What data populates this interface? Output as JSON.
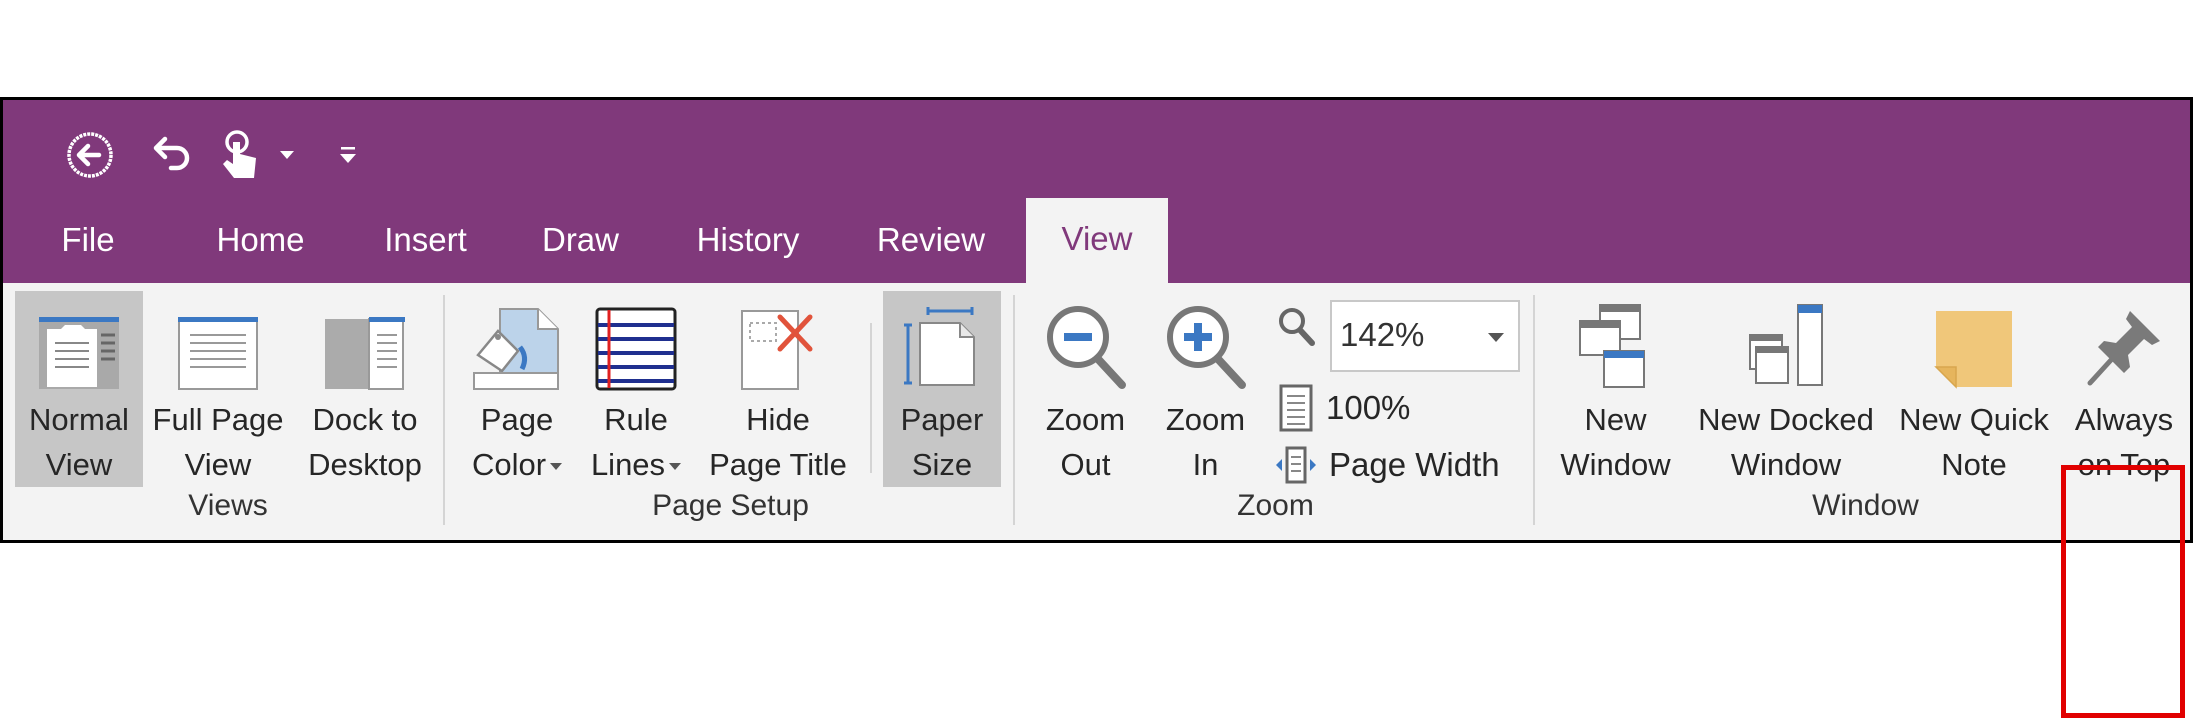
{
  "colors": {
    "brand": "#80397b",
    "ribbon_bg": "#f3f3f3",
    "selected_bg": "#c6c6c6",
    "highlight": "#e10000",
    "icon_blue": "#3b78c3"
  },
  "quick_access_toolbar": [
    {
      "name": "back-icon",
      "label": "Back"
    },
    {
      "name": "undo-icon",
      "label": "Undo"
    },
    {
      "name": "touch-mode-icon",
      "label": "Touch/Mouse Mode"
    },
    {
      "name": "customize-qat-icon",
      "label": "Customize Quick Access Toolbar"
    }
  ],
  "tabs": [
    {
      "label": "File",
      "active": false
    },
    {
      "label": "Home",
      "active": false
    },
    {
      "label": "Insert",
      "active": false
    },
    {
      "label": "Draw",
      "active": false
    },
    {
      "label": "History",
      "active": false
    },
    {
      "label": "Review",
      "active": false
    },
    {
      "label": "View",
      "active": true
    }
  ],
  "groups": {
    "views": {
      "label": "Views",
      "buttons": [
        {
          "line1": "Normal",
          "line2": "View",
          "selected": true
        },
        {
          "line1": "Full Page",
          "line2": "View",
          "selected": false
        },
        {
          "line1": "Dock to",
          "line2": "Desktop",
          "selected": false
        }
      ]
    },
    "page_setup": {
      "label": "Page Setup",
      "buttons": [
        {
          "line1": "Page",
          "line2": "Color",
          "dropdown": true
        },
        {
          "line1": "Rule",
          "line2": "Lines",
          "dropdown": true
        },
        {
          "line1": "Hide",
          "line2": "Page Title",
          "dropdown": false
        },
        {
          "line1": "Paper",
          "line2": "Size",
          "selected": true
        }
      ]
    },
    "zoom": {
      "label": "Zoom",
      "zoom_out": {
        "line1": "Zoom",
        "line2": "Out"
      },
      "zoom_in": {
        "line1": "Zoom",
        "line2": "In"
      },
      "zoom_value": "142%",
      "hundred_percent": "100%",
      "page_width": "Page Width"
    },
    "window": {
      "label": "Window",
      "buttons": [
        {
          "line1": "New",
          "line2": "Window"
        },
        {
          "line1": "New Docked",
          "line2": "Window"
        },
        {
          "line1": "New Quick",
          "line2": "Note"
        },
        {
          "line1": "Always",
          "line2": "on Top",
          "highlighted": true
        }
      ]
    }
  }
}
